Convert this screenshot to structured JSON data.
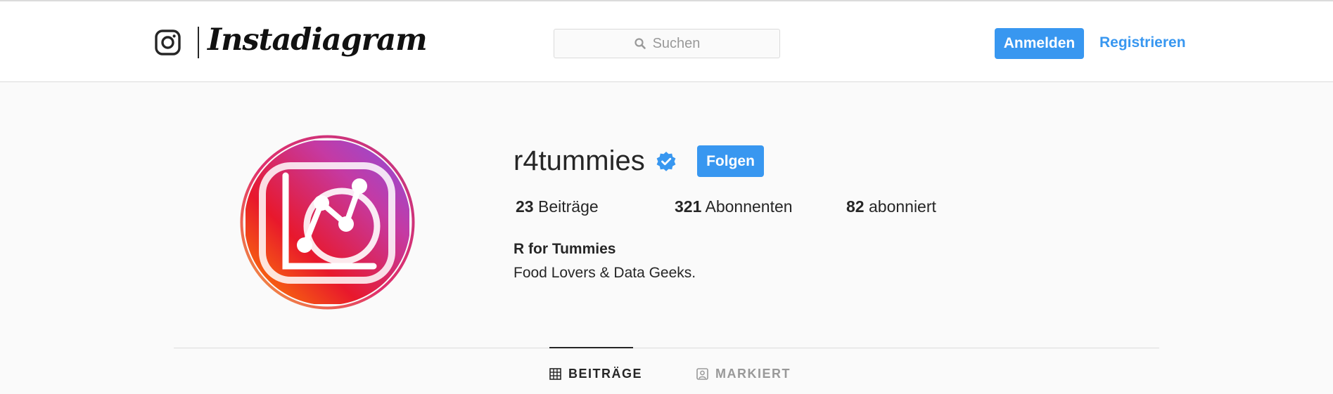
{
  "header": {
    "brand": "Instadiagram",
    "logo_icon": "camera-outline-icon",
    "search": {
      "placeholder": "Suchen",
      "icon": "search-icon"
    },
    "login_label": "Anmelden",
    "register_label": "Registrieren"
  },
  "profile": {
    "username": "r4tummies",
    "verified": true,
    "follow_label": "Folgen",
    "stats": [
      {
        "count": "23",
        "label": "Beiträge"
      },
      {
        "count": "321",
        "label": "Abonnenten"
      },
      {
        "count": "82",
        "label": "abonniert"
      }
    ],
    "full_name": "R for Tummies",
    "bio": "Food Lovers & Data Geeks."
  },
  "tabs": [
    {
      "label": "BEITRÄGE",
      "icon": "grid-icon",
      "active": true
    },
    {
      "label": "MARKIERT",
      "icon": "tagged-person-icon",
      "active": false
    }
  ],
  "colors": {
    "accent": "#3897f0",
    "text": "#262626",
    "muted": "#999999",
    "background": "#fafafa"
  }
}
